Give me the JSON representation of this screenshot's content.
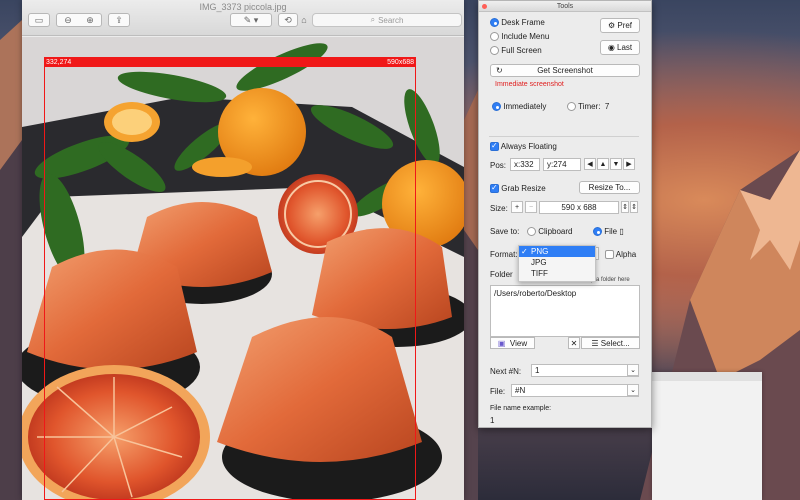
{
  "preview": {
    "title": "IMG_3373 piccola.jpg",
    "search_placeholder": "Search",
    "selection_origin": "332,274",
    "selection_size": "590x688"
  },
  "tools": {
    "title": "Tools",
    "capture_modes": [
      "Desk Frame",
      "Include Menu",
      "Full Screen"
    ],
    "selected_mode": "Desk Frame",
    "pref_label": "Pref",
    "last_label": "Last",
    "get_screenshot_label": "Get Screenshot",
    "immediate_note": "Immediate screenshot",
    "immediately_label": "Immediately",
    "timer_label": "Timer:",
    "timer_value": "7",
    "always_floating_label": "Always Floating",
    "pos_label": "Pos:",
    "pos_x": "x:332",
    "pos_y": "y:274",
    "grab_resize_label": "Grab Resize",
    "resize_to_label": "Resize To...",
    "size_label": "Size:",
    "size_value": "590 x 688",
    "save_to_label": "Save to:",
    "clipboard_label": "Clipboard",
    "file_label": "File",
    "format_label": "Format:",
    "formats": [
      "PNG",
      "JPG",
      "TIFF"
    ],
    "selected_format": "PNG",
    "alpha_label": "Alpha",
    "folder_label": "Folder",
    "drop_hint": "p a folder here",
    "folder_path": "/Users/roberto/Desktop",
    "view_label": "View",
    "select_label": "Select...",
    "next_n_label": "Next #N:",
    "next_n_value": "1",
    "file_name_label": "File:",
    "file_name_value": "#N",
    "example_label": "File name example:",
    "example_value": "1"
  },
  "colors": {
    "selection_red": "#f01818",
    "accent_blue": "#2f7ef5",
    "warning_red": "#e02020"
  }
}
